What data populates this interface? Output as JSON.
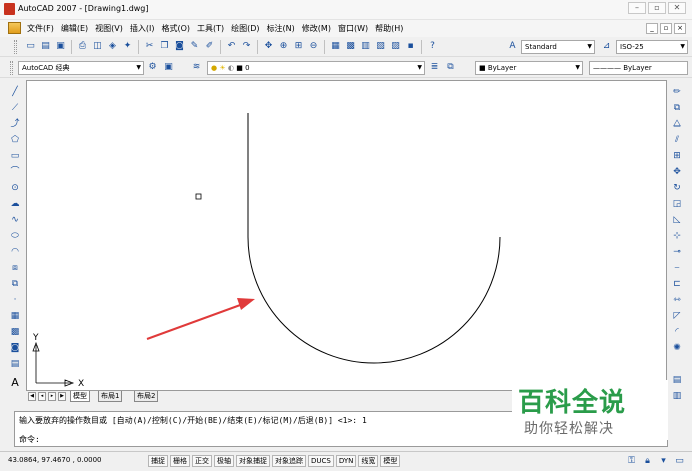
{
  "window": {
    "title": "AutoCAD 2007 - [Drawing1.dwg]",
    "min": "–",
    "max": "▫",
    "close": "✕"
  },
  "menu": [
    "文件(F)",
    "编辑(E)",
    "视图(V)",
    "插入(I)",
    "格式(O)",
    "工具(T)",
    "绘图(D)",
    "标注(N)",
    "修改(M)",
    "窗口(W)",
    "帮助(H)"
  ],
  "doc_controls": {
    "min": "_",
    "restore": "▫",
    "close": "×"
  },
  "toolbar1": {
    "text_style": "Standard",
    "dim_style": "ISO-25"
  },
  "toolbar2": {
    "workspace": "AutoCAD 经典",
    "layer": "0",
    "color": "ByLayer",
    "linetype": "ByLayer"
  },
  "canvas": {
    "ucs_y": "Y",
    "ucs_x": "X"
  },
  "tabs": [
    "模型",
    "布局1",
    "布局2"
  ],
  "command": {
    "line1": "输入要放弃的操作数目或 [自动(A)/控制(C)/开始(BE)/结束(E)/标记(M)/后退(B)] <1>: 1",
    "line2": "命令:"
  },
  "status": {
    "coords": "43.0864, 97.4670 , 0.0000",
    "toggles": [
      "捕捉",
      "栅格",
      "正交",
      "极轴",
      "对象捕捉",
      "对象追踪",
      "DUCS",
      "DYN",
      "线宽",
      "模型"
    ]
  },
  "watermark": {
    "title": "百科全说",
    "subtitle": "助你轻松解决"
  },
  "colors": {
    "arrow": "#e03a3a",
    "watermark_green": "#2a9c4a",
    "canvas_bg": "#ffffff"
  }
}
